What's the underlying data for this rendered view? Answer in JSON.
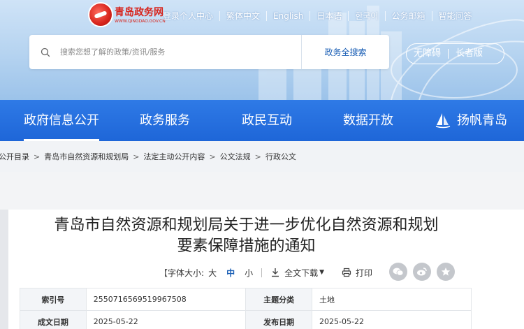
{
  "logo": {
    "name": "青岛政务网",
    "sub": "WWW.QINGDAO.GOV.CN"
  },
  "topnav": [
    "登录个人中心",
    "繁体中文",
    "English",
    "日本语",
    "한국어",
    "公务邮箱",
    "智能问答"
  ],
  "search": {
    "placeholder": "搜索您想了解的政策/资讯/服务",
    "button": "政务全搜索"
  },
  "access": {
    "barrier_free": "无障碍",
    "elder": "长者版"
  },
  "mainnav": {
    "items": [
      "政府信息公开",
      "政务服务",
      "政民互动",
      "数据开放",
      "扬帆青岛"
    ],
    "active": "政府信息公开"
  },
  "breadcrumb": [
    "公开目录",
    "青岛市自然资源和规划局",
    "法定主动公开内容",
    "公文法规",
    "行政公文"
  ],
  "article": {
    "title_line1": "青岛市自然资源和规划局关于进一步优化自然资源和规划",
    "title_line2": "要素保障措施的通知"
  },
  "toolbar": {
    "font_size_label": "字体大小:",
    "size_large": "大",
    "size_medium": "中",
    "size_small": "小",
    "download": "全文下载",
    "print": "打印",
    "bracket_open": "【"
  },
  "share": {
    "wechat_icon": "wechat-icon",
    "weibo_icon": "weibo-icon",
    "favorite_icon": "star-icon"
  },
  "meta": {
    "rows": [
      {
        "k1": "索引号",
        "v1": "2550716569519967508",
        "k2": "主题分类",
        "v2": "土地"
      },
      {
        "k1": "成文日期",
        "v1": "2025-05-22",
        "k2": "发布日期",
        "v2": "2025-05-22"
      }
    ]
  },
  "colors": {
    "primary": "#1e66d8",
    "accent_red": "#d7241c"
  }
}
